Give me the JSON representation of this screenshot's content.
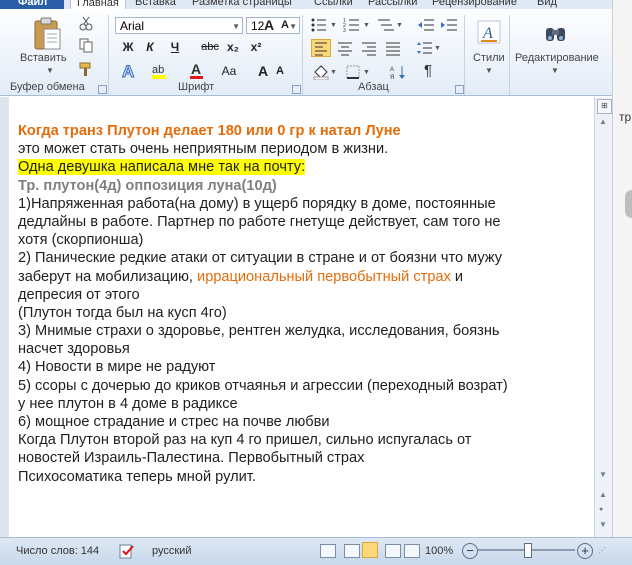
{
  "ribbon_tabs": {
    "file": "Файл",
    "home": "Главная",
    "insert": "Вставка",
    "layout": "Разметка страницы",
    "refs": "Ссылки",
    "mailings": "Рассылки",
    "review": "Рецензирование",
    "view": "Вид"
  },
  "clipboard": {
    "paste_label": "Вставить",
    "group_title": "Буфер обмена"
  },
  "font": {
    "name_value": "Arial",
    "size_value": "12",
    "bold": "Ж",
    "italic": "К",
    "underline": "Ч",
    "strike": "abc",
    "subscript": "x₂",
    "superscript": "x²",
    "grow": "A",
    "shrink": "A",
    "case": "Aa",
    "group_title": "Шрифт"
  },
  "paragraph": {
    "group_title": "Абзац"
  },
  "styles": {
    "label": "Стили"
  },
  "editing": {
    "label": "Редактирование"
  },
  "right_pane": {
    "fragment": "тр"
  },
  "document": {
    "lines": [
      [
        "Когда транз Плутон делает 180 или 0 гр  к  натал Луне"
      ],
      [
        "это может стать очень неприятным периодом в жизни."
      ],
      [
        "Одна девушка написала мне так на почту:"
      ],
      [
        "Тр. плутон(4д) оппозиция луна(10д)"
      ],
      [
        "1)Напряженная работа(на дому) в ущерб порядку в доме, постоянные"
      ],
      [
        "дедлайны в работе. Партнер по работе гнетуще действует, сам того не"
      ],
      [
        "хотя (скорпионша)"
      ],
      [
        "2) Панические редкие атаки от ситуации в стране и от боязни что мужу"
      ],
      [
        "заберут на мобилизацию, ",
        "иррациональный первобытный страх",
        " и"
      ],
      [
        "депресия от этого"
      ],
      [
        "(Плутон тогда был на куcп 4го)"
      ],
      [
        "3) Мнимые страхи о здоровье, рентген желудка, исследования,  боязнь"
      ],
      [
        "насчет здоровья"
      ],
      [
        "4) Новости в мире не радуют"
      ],
      [
        "5) ссоры с дочерью до криков отчаянья и агрессии (переходный возрат)"
      ],
      [
        "у нее плутон в 4 доме в радиксе"
      ],
      [
        "6) мощное страдание и стрес на почве любви"
      ],
      [
        "Когда Плутон второй раз на куп 4 го пришел, сильно испугалась от"
      ],
      [
        "новостей Израиль-Палестина. Первобытный страх"
      ],
      [
        "Психосоматика теперь мной рулит."
      ]
    ]
  },
  "status": {
    "word_count": "Число слов: 144",
    "language": "русский",
    "zoom": "100%",
    "minus": "−",
    "plus": "+"
  },
  "zoom_level_fraction": 0.5
}
